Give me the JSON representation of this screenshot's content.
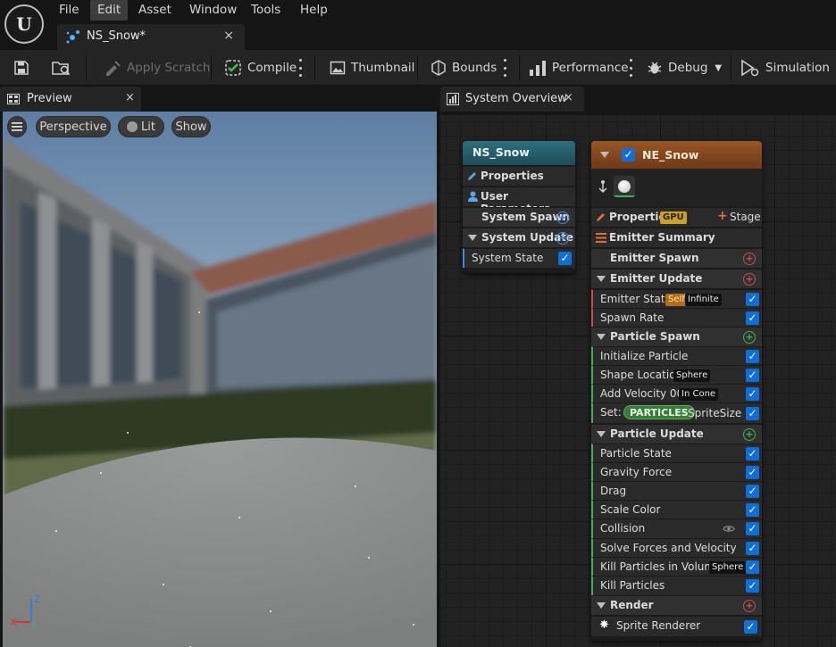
{
  "menu": [
    "File",
    "Edit",
    "Asset",
    "Window",
    "Tools",
    "Help"
  ],
  "menu_active": "Edit",
  "document_tab": {
    "title": "NS_Snow*",
    "close": "×"
  },
  "toolbar": {
    "apply_scratch": "Apply Scratch",
    "compile": "Compile",
    "thumbnail": "Thumbnail",
    "bounds": "Bounds",
    "performance": "Performance",
    "debug": "Debug",
    "simulation": "Simulation"
  },
  "panels": {
    "preview": {
      "title": "Preview",
      "close": "×"
    },
    "system_overview": {
      "title": "System Overview",
      "close": "×"
    }
  },
  "viewport": {
    "perspective": "Perspective",
    "lit": "Lit",
    "show": "Show",
    "axis_x": "X",
    "axis_z": "Z"
  },
  "system_node": {
    "title": "NS_Snow",
    "properties": "Properties",
    "user_parameters": "User Parameters",
    "system_spawn": "System Spawn",
    "system_update": "System Update",
    "system_state": "System State"
  },
  "emitter_node": {
    "title": "NE_Snow",
    "properties": "Properties",
    "gpu_badge": "GPU",
    "stage": "Stage",
    "emitter_summary": "Emitter Summary",
    "emitter_spawn": "Emitter Spawn",
    "emitter_update": "Emitter Update",
    "emitter_state": "Emitter State",
    "emitter_state_badge1": "Self",
    "emitter_state_badge2": "Infinite",
    "spawn_rate": "Spawn Rate",
    "particle_spawn": "Particle Spawn",
    "initialize_particle": "Initialize Particle",
    "shape_location": "Shape Location",
    "shape_location_badge": "Sphere",
    "add_velocity": "Add Velocity 001",
    "add_velocity_badge": "In Cone",
    "set_label": "Set:",
    "set_pill": "PARTICLES",
    "set_value": "SpriteSize",
    "particle_update": "Particle Update",
    "particle_state": "Particle State",
    "gravity_force": "Gravity Force",
    "drag": "Drag",
    "scale_color": "Scale Color",
    "collision": "Collision",
    "solve_forces": "Solve Forces and Velocity",
    "kill_particles_volume": "Kill Particles in Volume",
    "kill_particles_volume_badge": "Sphere",
    "kill_particles": "Kill Particles",
    "render": "Render",
    "sprite_renderer": "Sprite Renderer"
  },
  "colors": {
    "system_header": "#2f6e7c",
    "emitter_header": "#8a4a1d",
    "accent_blue": "#0f6fd8"
  }
}
